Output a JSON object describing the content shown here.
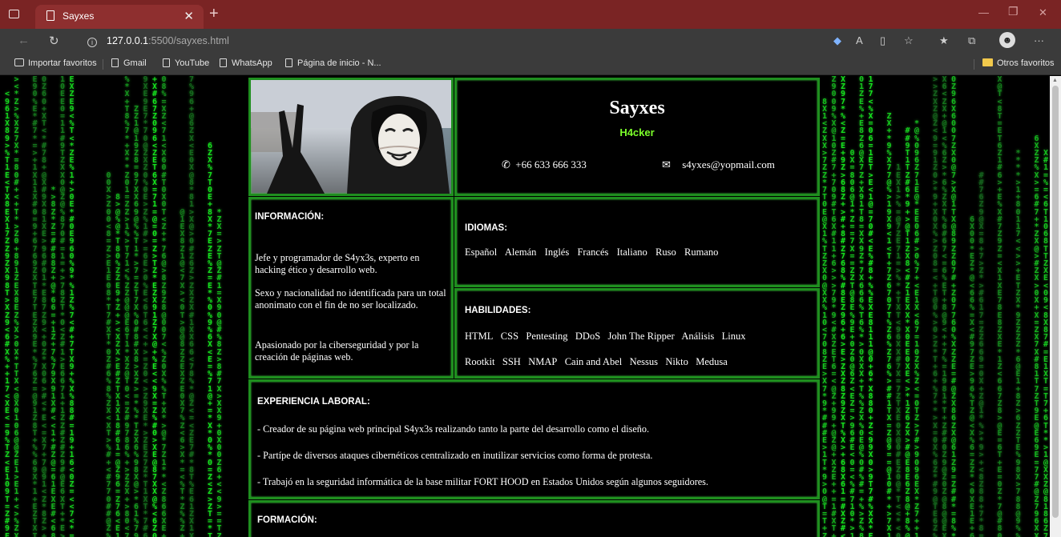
{
  "browser": {
    "tab_title": "Sayxes",
    "url_host": "127.0.0.1",
    "url_rest": ":5500/sayxes.html",
    "bookmarks": [
      "Importar favoritos",
      "Gmail",
      "YouTube",
      "WhatsApp",
      "Página de inicio - N...",
      "Otros favoritos"
    ]
  },
  "profile": {
    "name": "Sayxes",
    "role": "H4cker",
    "phone": "+66 633 666 333",
    "email": "s4yxes@yopmail.com"
  },
  "info": {
    "heading": "INFORMACIÓN:",
    "p1": "Jefe y programador de S4yx3s, experto en hacking ético y desarrollo web.",
    "p2": "Sexo y nacionalidad no identificada para un total anonimato con el fin de no ser localizado.",
    "p3": "Apasionado por la ciberseguridad y por la creación de páginas web."
  },
  "languages": {
    "heading": "IDIOMAS:",
    "items": [
      "Español",
      "Alemán",
      "Inglés",
      "Francés",
      "Italiano",
      "Ruso",
      "Rumano"
    ]
  },
  "skills": {
    "heading": "HABILIDADES:",
    "row1": [
      "HTML",
      "CSS",
      "Pentesting",
      "DDoS",
      "John The Ripper",
      "Análisis",
      "Linux"
    ],
    "row2": [
      "Rootkit",
      "SSH",
      "NMAP",
      "Cain and Abel",
      "Nessus",
      "Nikto",
      "Medusa"
    ]
  },
  "experience": {
    "heading": "EXPERIENCIA LABORAL:",
    "items": [
      "- Creador de su página web principal S4yx3s realizando tanto la parte del desarrollo como el diseño.",
      "- Partípe de diversos ataques cibernéticos centralizado en inutilizar servicios como forma de protesta.",
      "- Trabajó en la seguridad informática de la base militar FORT HOOD en Estados Unidos según algunos seguidores."
    ]
  },
  "education": {
    "heading": "FORMACIÓN:"
  },
  "colors": {
    "accent_green": "#1f8f1f",
    "role_green": "#7cff2a",
    "titlebar": "#7a2424",
    "toolbar": "#3b3b3b"
  }
}
